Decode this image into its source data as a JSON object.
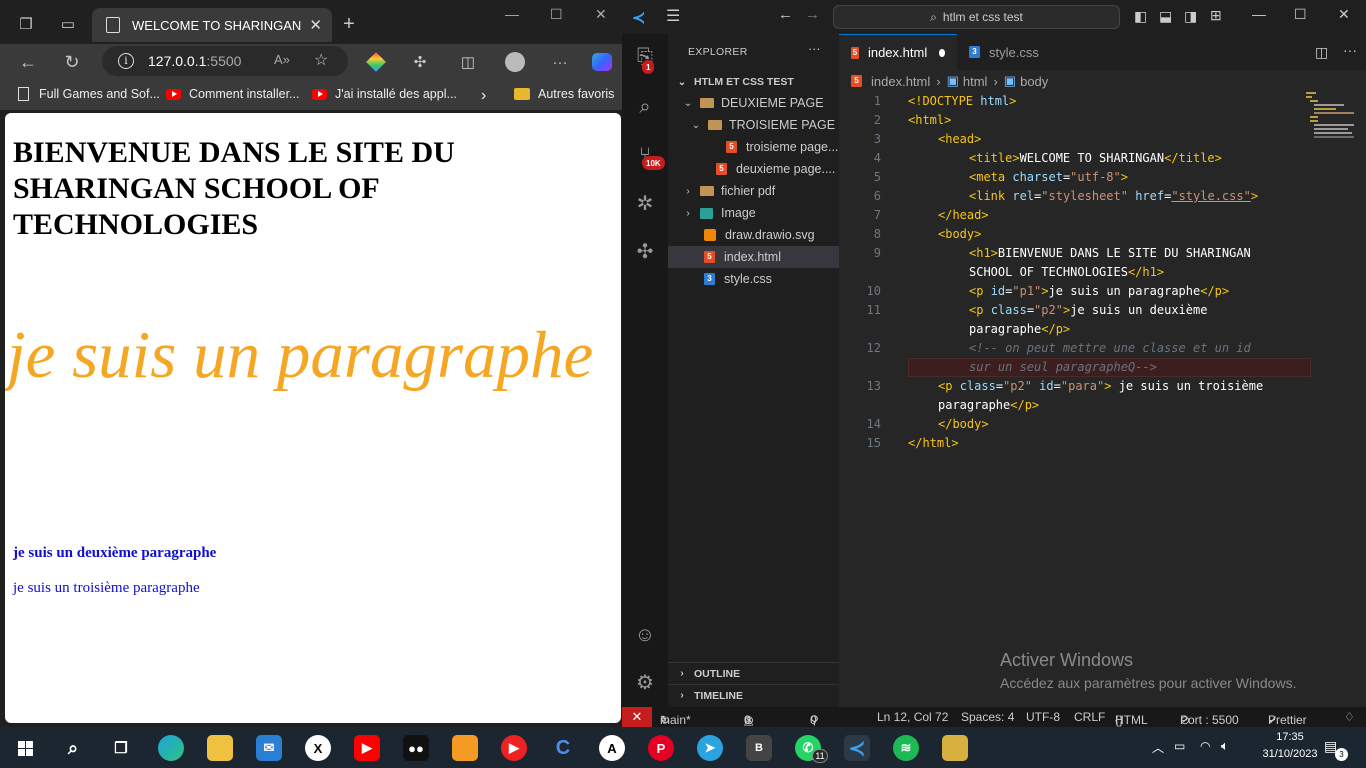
{
  "browser": {
    "tab_title": "WELCOME TO SHARINGAN",
    "address_host": "127.0.0.1",
    "address_port": ":5500",
    "bookmarks": [
      {
        "label": "Full Games and Sof..."
      },
      {
        "label": "Comment installer..."
      },
      {
        "label": "J'ai installé des appl..."
      },
      {
        "label": "Autres favoris"
      }
    ],
    "page": {
      "h1": "BIENVENUE DANS LE SITE DU SHARINGAN SCHOOL OF TECHNOLOGIES",
      "p1": "je suis un paragraphe",
      "p2": "je suis un deuxième paragraphe",
      "p3": "je suis un troisième paragraphe"
    }
  },
  "vscode": {
    "search": "htlm et css test",
    "explorer_label": "EXPLORER",
    "project": "HTLM ET CSS TEST",
    "badges": {
      "explorer": "1",
      "scm": "10K"
    },
    "tree": [
      {
        "label": "DEUXIEME PAGE"
      },
      {
        "label": "TROISIEME PAGE"
      },
      {
        "label": "troisieme page..."
      },
      {
        "label": "deuxieme page...."
      },
      {
        "label": "fichier pdf"
      },
      {
        "label": "Image"
      },
      {
        "label": "draw.drawio.svg"
      },
      {
        "label": "index.html"
      },
      {
        "label": "style.css"
      }
    ],
    "outline": "OUTLINE",
    "timeline": "TIMELINE",
    "tabs": [
      {
        "label": "index.html"
      },
      {
        "label": "style.css"
      }
    ],
    "breadcrumb": [
      "index.html",
      "html",
      "body"
    ],
    "line_numbers": [
      "1",
      "2",
      "3",
      "4",
      "5",
      "6",
      "7",
      "8",
      "9",
      "10",
      "11",
      "12",
      "13",
      "14",
      "15"
    ],
    "code": {
      "l1a": "<!DOCTYPE ",
      "l1b": "html",
      "l1c": ">",
      "l2": "<html>",
      "l3": "<head>",
      "l4a": "<title>",
      "l4b": "WELCOME TO SHARINGAN",
      "l4c": "</title>",
      "l5a": "<meta ",
      "l5b": "charset",
      "l5c": "=",
      "l5d": "\"utf-8\"",
      "l5e": ">",
      "l6a": "<link ",
      "l6b": "rel",
      "l6c": "=",
      "l6d": "\"stylesheet\"",
      "l6e": " href",
      "l6f": "=",
      "l6g": "\"style.css\"",
      "l6h": ">",
      "l7": "</head>",
      "l8": "<body>",
      "l9a": "<h1>",
      "l9b": "BIENVENUE DANS LE SITE DU SHARINGAN",
      "l9c": "SCHOOL OF TECHNOLOGIES",
      "l9d": "</h1>",
      "l10a": "<p ",
      "l10b": "id",
      "l10c": "=",
      "l10d": "\"p1\"",
      "l10e": ">",
      "l10f": "je suis un paragraphe",
      "l10g": "</p>",
      "l11a": "<p ",
      "l11b": "class",
      "l11c": "=",
      "l11d": "\"p2\"",
      "l11e": ">",
      "l11f": "je suis un deuxième",
      "l11g": "paragraphe",
      "l11h": "</p>",
      "l12a": "<!-- on peut mettre une classe et un id",
      "l12b": "sur un seul paragrapheQ-->",
      "l13a": "<p ",
      "l13b": "class",
      "l13c": "=",
      "l13d": "\"p2\"",
      "l13e": " id",
      "l13f": "=",
      "l13g": "\"para\"",
      "l13h": ">",
      "l13i": " je suis un troisième",
      "l13j": "paragraphe",
      "l13k": "</p>",
      "l14": "</body>",
      "l15": "</html>"
    },
    "watermark_title": "Activer Windows",
    "watermark_sub": "Accédez aux paramètres pour activer Windows.",
    "status": {
      "branch": "main*",
      "errors": "0",
      "warnings": "0",
      "ports": "0",
      "position": "Ln 12, Col 72",
      "spaces": "Spaces: 4",
      "encoding": "UTF-8",
      "eol": "CRLF",
      "language": "HTML",
      "port": "Port : 5500",
      "prettier": "Prettier"
    }
  },
  "taskbar": {
    "whatsapp_badge": "11",
    "time": "17:35",
    "date": "31/10/2023",
    "notifications": "3"
  }
}
